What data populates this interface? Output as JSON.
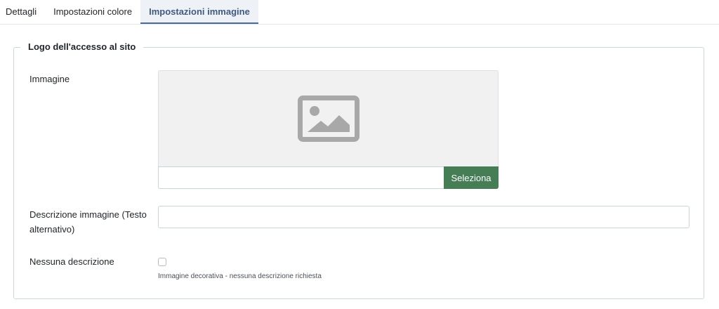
{
  "tabs": [
    {
      "label": "Dettagli",
      "active": false
    },
    {
      "label": "Impostazioni colore",
      "active": false
    },
    {
      "label": "Impostazioni immagine",
      "active": true
    }
  ],
  "fieldset": {
    "legend": "Logo dell'accesso al sito"
  },
  "image_field": {
    "label": "Immagine",
    "value": "",
    "select_label": "Seleziona",
    "placeholder_icon": "image-placeholder-icon"
  },
  "alt_field": {
    "label_line1": "Descrizione immagine (Testo",
    "label_line2": "alternativo)",
    "value": ""
  },
  "no_desc_field": {
    "label": "Nessuna descrizione",
    "checked": false,
    "hint": "Immagine decorativa - nessuna descrizione richiesta"
  },
  "colors": {
    "active_tab_text": "#3f5a80",
    "active_tab_bg": "#eef2f7",
    "select_button": "#457d54",
    "icon_gray": "#a8a8a8"
  }
}
